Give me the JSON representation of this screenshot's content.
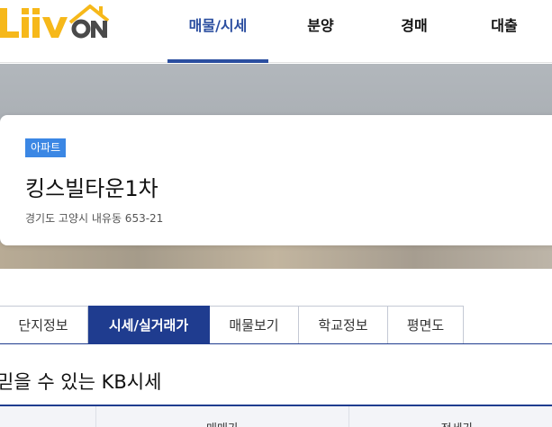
{
  "brand": {
    "name": "Liiv ON"
  },
  "nav": {
    "items": [
      {
        "label": "매물/시세",
        "active": true
      },
      {
        "label": "분양",
        "active": false
      },
      {
        "label": "경매",
        "active": false
      },
      {
        "label": "대출",
        "active": false
      }
    ]
  },
  "property": {
    "type_badge": "아파트",
    "name": "킹스빌타운1차",
    "address": "경기도 고양시 내유동 653-21"
  },
  "tabs": [
    {
      "label": "단지정보",
      "active": false
    },
    {
      "label": "시세/실거래가",
      "active": true
    },
    {
      "label": "매물보기",
      "active": false
    },
    {
      "label": "학교정보",
      "active": false
    },
    {
      "label": "평면도",
      "active": false
    }
  ],
  "section": {
    "title": "믿을 수 있는 KB시세"
  },
  "table": {
    "headers": [
      "매매가",
      "전세가"
    ]
  },
  "colors": {
    "brand_blue": "#2b4ea0",
    "tab_active": "#1f3c8f",
    "badge": "#3b87e4",
    "logo_yellow": "#f6b81a",
    "logo_dark": "#4a4a4a"
  }
}
